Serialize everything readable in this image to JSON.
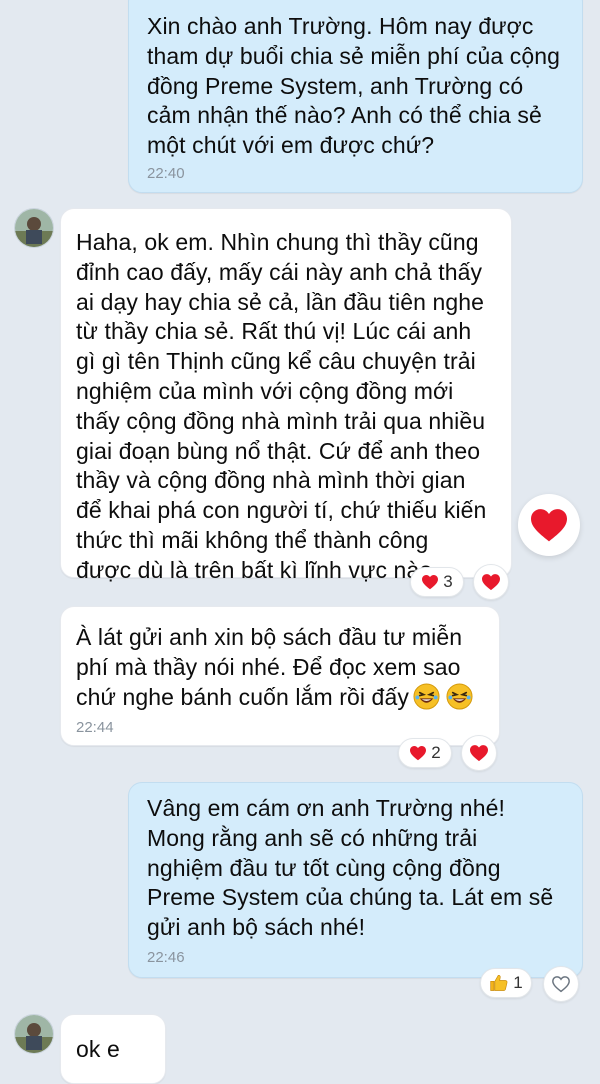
{
  "messages": [
    {
      "text": "Xin chào anh Trường. Hôm nay được\ntham dự buổi chia sẻ miễn phí của cộng\nđồng Preme System, anh Trường có\ncảm nhận thế nào? Anh có thể chia sẻ\nmột chút với em được chứ?",
      "time": "22:40"
    },
    {
      "text": "Haha, ok em. Nhìn chung thì thầy cũng\nđỉnh cao đấy, mấy cái này anh chả thấy\nai dạy hay chia sẻ cả, lần đầu tiên nghe\ntừ thầy chia sẻ. Rất thú vị! Lúc cái anh\ngì gì tên Thịnh cũng kể câu chuyện trải\nnghiệm của mình với cộng đồng mới\nthấy cộng đồng nhà mình trải qua nhiều\ngiai đoạn bùng nổ thật. Cứ để anh theo\nthầy và cộng đồng nhà mình thời gian\nđể khai phá con người tí, chứ thiếu kiến\nthức thì mãi không thể thành công\nđược dù là trên bất kì lĩnh vực nào.",
      "reaction_count": "3"
    },
    {
      "text": "À lát gửi anh xin bộ sách đầu tư miễn\nphí mà thầy nói nhé. Để đọc xem sao\nchứ nghe bánh cuốn lắm rồi đấy",
      "time": "22:44",
      "reaction_count": "2"
    },
    {
      "text": "Vâng em cám ơn anh Trường nhé!\nMong rằng anh sẽ có những trải\nnghiệm đầu tư tốt cùng cộng đồng\nPreme System của chúng ta. Lát em sẽ\ngửi anh bộ sách nhé!",
      "time": "22:46",
      "reaction_count": "1"
    },
    {
      "text": "ok e"
    }
  ],
  "icons": {
    "heart": "heart-icon",
    "heart_outline": "heart-outline-icon",
    "thumbs_up": "thumbs-up-icon",
    "laugh_emoji": "laughing-emoji-icon"
  },
  "colors": {
    "background": "#e3e9f0",
    "outgoing_bubble": "#d4ecfb",
    "incoming_bubble": "#ffffff",
    "heart": "#e8192c"
  }
}
